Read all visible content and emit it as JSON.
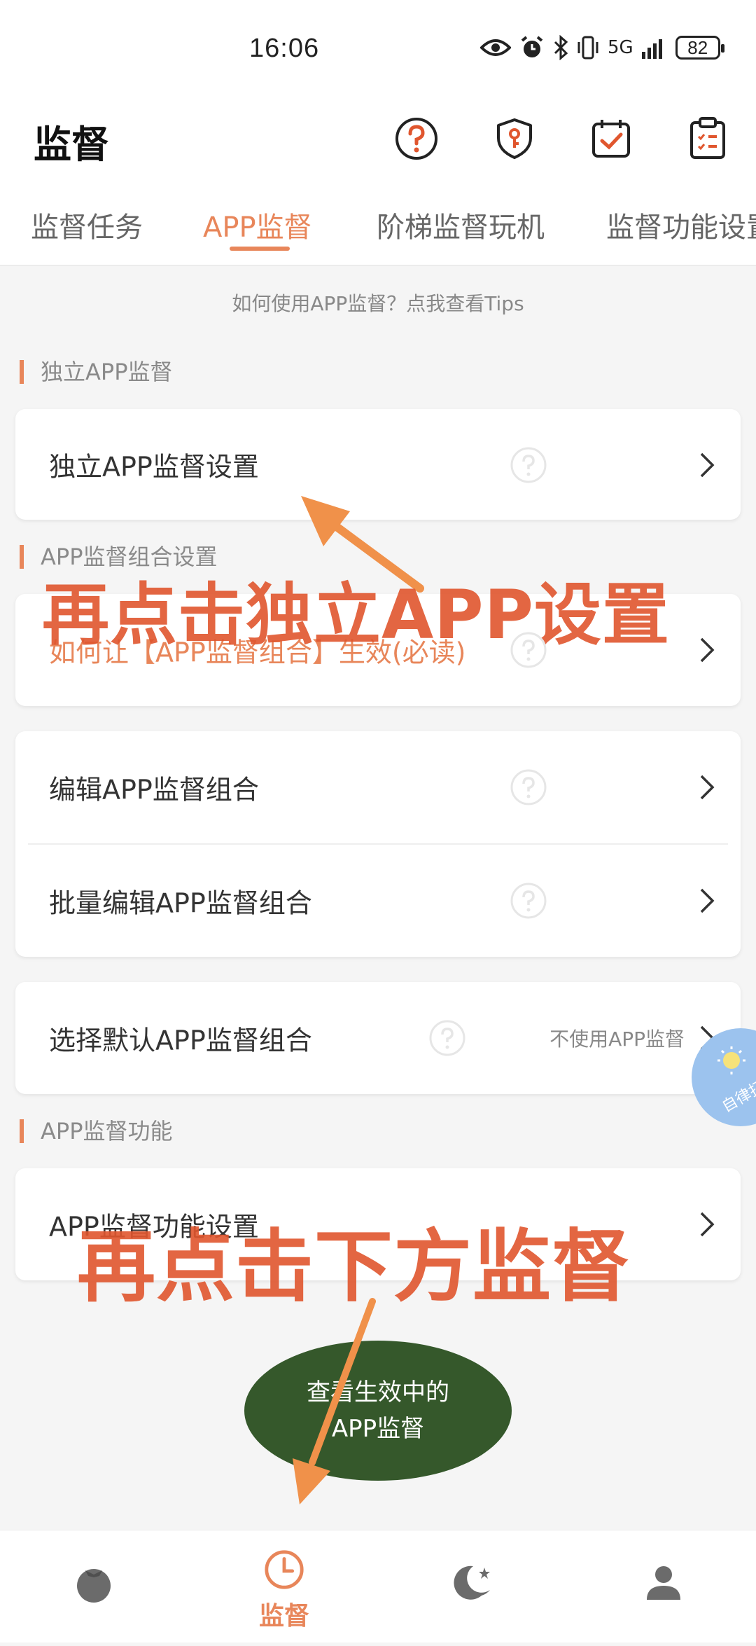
{
  "status_bar": {
    "time": "16:06",
    "network": "5G",
    "battery": "82",
    "icons": [
      "eye-icon",
      "alarm-icon",
      "bluetooth-icon",
      "vibrate-icon",
      "signal-icon",
      "battery-icon"
    ]
  },
  "header": {
    "title": "监督",
    "action_icons": [
      "help-circle-icon",
      "shield-key-icon",
      "calendar-check-icon",
      "clipboard-list-icon"
    ]
  },
  "tabs": [
    {
      "label": "监督任务",
      "active": false
    },
    {
      "label": "APP监督",
      "active": true
    },
    {
      "label": "阶梯监督玩机",
      "active": false
    },
    {
      "label": "监督功能设置",
      "active": false
    }
  ],
  "tips_link": "如何使用APP监督？点我查看Tips",
  "sections": {
    "independent": {
      "title": "独立APP监督",
      "rows": [
        {
          "label": "独立APP监督设置"
        }
      ]
    },
    "combo": {
      "title": "APP监督组合设置",
      "rows": [
        {
          "label": "如何让【APP监督组合】生效(必读)"
        },
        {
          "label": "编辑APP监督组合"
        },
        {
          "label": "批量编辑APP监督组合"
        },
        {
          "label": "选择默认APP监督组合",
          "value": "不使用APP监督"
        }
      ]
    },
    "functions": {
      "title": "APP监督功能",
      "rows": [
        {
          "label": "APP监督功能设置"
        }
      ]
    }
  },
  "floating_bubble": {
    "text": "自律打"
  },
  "fab": {
    "line1": "查看生效中的",
    "line2": "APP监督"
  },
  "bottom_nav": [
    {
      "icon": "tomato-icon",
      "label": ""
    },
    {
      "icon": "clock-icon",
      "label": "监督",
      "active": true
    },
    {
      "icon": "moon-star-icon",
      "label": ""
    },
    {
      "icon": "user-icon",
      "label": ""
    }
  ],
  "annotations": {
    "top": "再点击独立APP设置",
    "bottom": "再点击下方监督"
  },
  "colors": {
    "accent": "#e8865a",
    "annotation": "#e0562e",
    "arrow": "#f0914a",
    "fab": "#35582b",
    "background": "#f5f5f5"
  }
}
